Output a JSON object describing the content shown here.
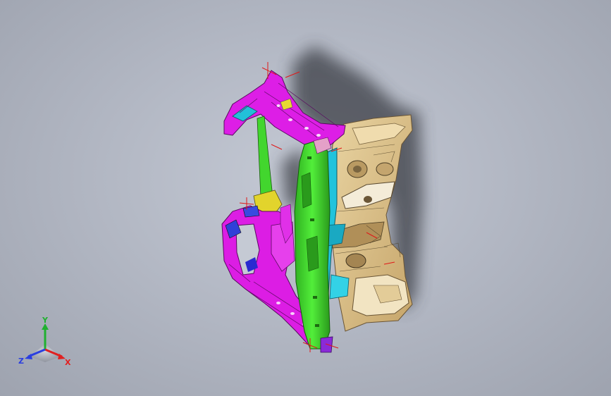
{
  "viewport": {
    "model": "cad-assembly-body-front-end-module",
    "background": "#b7bcc7"
  },
  "triad": {
    "y_label": "Y",
    "x_label": "X",
    "z_label": "Z",
    "x_color": "#e02020",
    "y_color": "#20b030",
    "z_color": "#2a3ee0"
  },
  "colors": {
    "magenta": "#e01ee8",
    "green": "#3ddc2a",
    "cyan": "#22c6de",
    "tan": "#d8bf8a",
    "yellow": "#e8d832",
    "shadow": "#3c3f46"
  }
}
